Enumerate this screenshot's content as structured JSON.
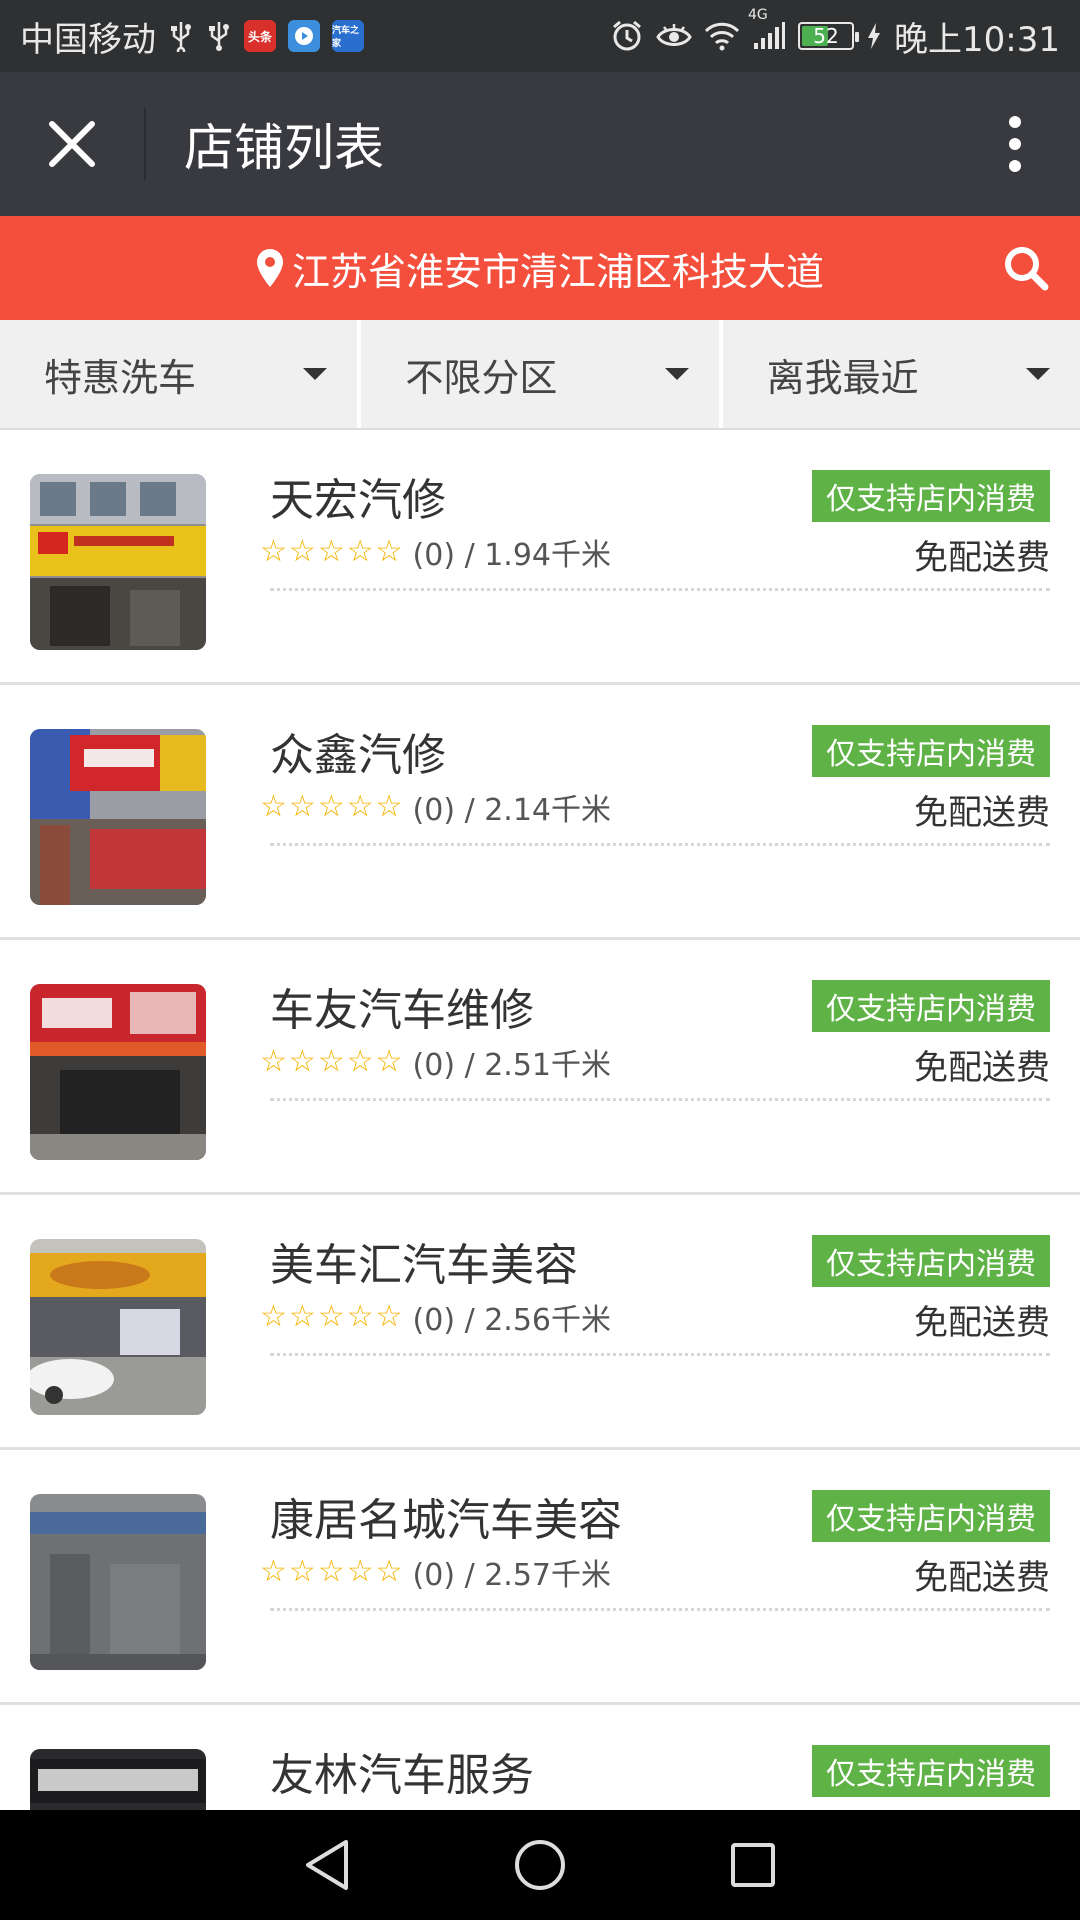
{
  "status_bar": {
    "carrier": "中国移动",
    "time": "晚上10:31",
    "battery_level": "52",
    "network_type": "4G",
    "notification_apps": [
      "头条",
      "视频",
      "汽车之家"
    ],
    "icons": [
      "usb-icon",
      "usb-icon",
      "toutiao-app-icon",
      "video-app-icon",
      "autohome-app-icon",
      "alarm-icon",
      "eye-icon",
      "wifi-icon",
      "signal-icon",
      "battery-icon",
      "charging-icon"
    ]
  },
  "title_bar": {
    "title": "店铺列表",
    "close_icon": "close-icon",
    "more_icon": "more-vertical-icon"
  },
  "location_bar": {
    "address": "江苏省淮安市清江浦区科技大道",
    "pin_icon": "map-pin-icon",
    "search_icon": "search-icon",
    "bg_color": "#f44e3c"
  },
  "filters": [
    {
      "label": "特惠洗车"
    },
    {
      "label": "不限分区"
    },
    {
      "label": "离我最近"
    }
  ],
  "shops": [
    {
      "name": "天宏汽修",
      "rating_count": "(0) / 1.94千米",
      "stars": 0,
      "badge": "仅支持店内消费",
      "delivery": "免配送费"
    },
    {
      "name": "众鑫汽修",
      "rating_count": "(0) / 2.14千米",
      "stars": 0,
      "badge": "仅支持店内消费",
      "delivery": "免配送费"
    },
    {
      "name": "车友汽车维修",
      "rating_count": "(0) / 2.51千米",
      "stars": 0,
      "badge": "仅支持店内消费",
      "delivery": "免配送费"
    },
    {
      "name": "美车汇汽车美容",
      "rating_count": "(0) / 2.56千米",
      "stars": 0,
      "badge": "仅支持店内消费",
      "delivery": "免配送费"
    },
    {
      "name": "康居名城汽车美容",
      "rating_count": "(0) / 2.57千米",
      "stars": 0,
      "badge": "仅支持店内消费",
      "delivery": "免配送费"
    },
    {
      "name": "友林汽车服务",
      "rating_count": "",
      "stars": 0,
      "badge": "仅支持店内消费",
      "delivery": ""
    }
  ],
  "colors": {
    "badge_green": "#5fb246",
    "star_yellow": "#f5b301",
    "title_bar_bg": "#393a3f"
  },
  "nav_bar": {
    "icons": [
      "back-icon",
      "home-icon",
      "recents-icon"
    ]
  }
}
